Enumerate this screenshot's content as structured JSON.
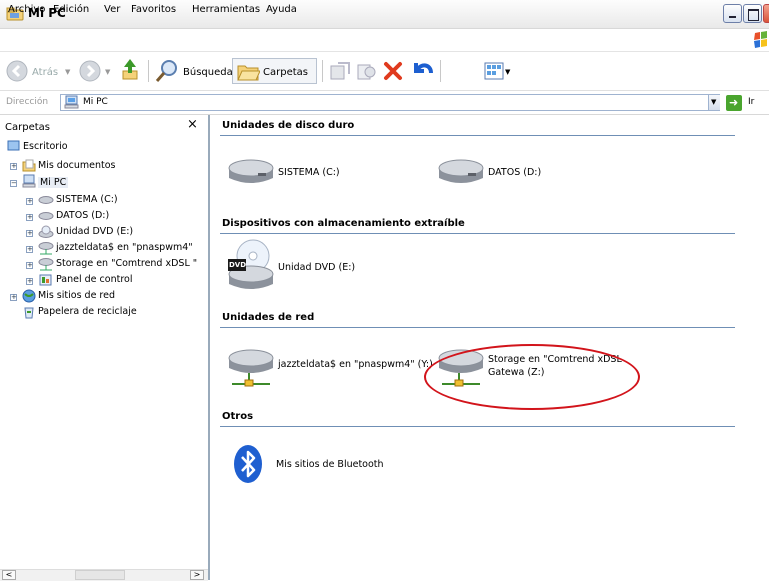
{
  "window": {
    "title": "Mi PC"
  },
  "menu": [
    "Archivo",
    "Edición",
    "Ver",
    "Favoritos",
    "Herramientas",
    "Ayuda"
  ],
  "toolbar": {
    "back_label": "Atrás",
    "search_label": "Búsqueda",
    "folders_label": "Carpetas"
  },
  "address": {
    "label": "Dirección",
    "value": "Mi PC",
    "go_label": "Ir"
  },
  "folders_pane": {
    "title": "Carpetas",
    "close": "×",
    "tree": [
      {
        "label": "Escritorio"
      },
      {
        "label": "Mis documentos"
      },
      {
        "label": "Mi PC"
      },
      {
        "label": "SISTEMA (C:)"
      },
      {
        "label": "DATOS (D:)"
      },
      {
        "label": "Unidad DVD (E:)"
      },
      {
        "label": "jazzteldata$ en \"pnaspwm4\""
      },
      {
        "label": "Storage en \"Comtrend xDSL \""
      },
      {
        "label": "Panel de control"
      },
      {
        "label": "Mis sitios de red"
      },
      {
        "label": "Papelera de reciclaje"
      }
    ]
  },
  "groups": {
    "hard_drives": {
      "title": "Unidades de disco duro",
      "items": [
        "SISTEMA (C:)",
        "DATOS (D:)"
      ]
    },
    "removable": {
      "title": "Dispositivos con almacenamiento extraíble",
      "items": [
        "Unidad DVD (E:)"
      ],
      "dvd_badge": "DVD"
    },
    "network": {
      "title": "Unidades de red",
      "items": [
        "jazzteldata$ en \"pnaspwm4\" (Y:)",
        "Storage en \"Comtrend xDSL",
        "Gatewa (Z:)"
      ]
    },
    "others": {
      "title": "Otros",
      "items": [
        "Mis sitios de Bluetooth"
      ]
    }
  },
  "colors": {
    "annotation": "#d2141b",
    "group_rule": "#6f8fb5"
  }
}
